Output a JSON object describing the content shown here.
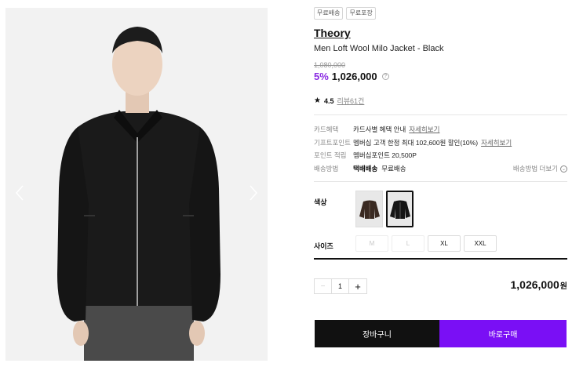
{
  "gallery": {
    "prev_icon": "chevron-left-icon",
    "next_icon": "chevron-right-icon"
  },
  "product": {
    "badges": [
      "무료배송",
      "무료포장"
    ],
    "brand": "Theory",
    "name": "Men Loft Wool Milo Jacket - Black",
    "original_price": "1,080,000",
    "discount": "5%",
    "price": "1,026,000",
    "info_icon": "?",
    "rating": "4.5",
    "reviews": "리뷰61건"
  },
  "benefits": {
    "card": {
      "label": "카드혜택",
      "value": "카드사별 혜택 안내",
      "link": "자세히보기"
    },
    "gift": {
      "label": "기프트포인트",
      "value": "멤버십 고객 한정 최대 102,600원 할인(10%)",
      "link": "자세히보기"
    },
    "points": {
      "label": "포인트 적립",
      "value": "멤버십포인트 20,500P"
    },
    "shipping": {
      "label": "배송방법",
      "method": "택배배송",
      "fee": "무료배송",
      "more": "배송방법 더보기"
    }
  },
  "options": {
    "color_label": "색상",
    "size_label": "사이즈",
    "sizes": [
      {
        "label": "M",
        "available": false
      },
      {
        "label": "L",
        "available": false
      },
      {
        "label": "XL",
        "available": true
      },
      {
        "label": "XXL",
        "available": true
      }
    ]
  },
  "order": {
    "qty": "1",
    "minus": "−",
    "plus": "+",
    "total": "1,026,000",
    "currency": "원",
    "cart_label": "장바구니",
    "buy_label": "바로구매"
  },
  "colors": {
    "accent": "#7a0ff5",
    "discount": "#8a2be2",
    "cart_bg": "#111111"
  }
}
